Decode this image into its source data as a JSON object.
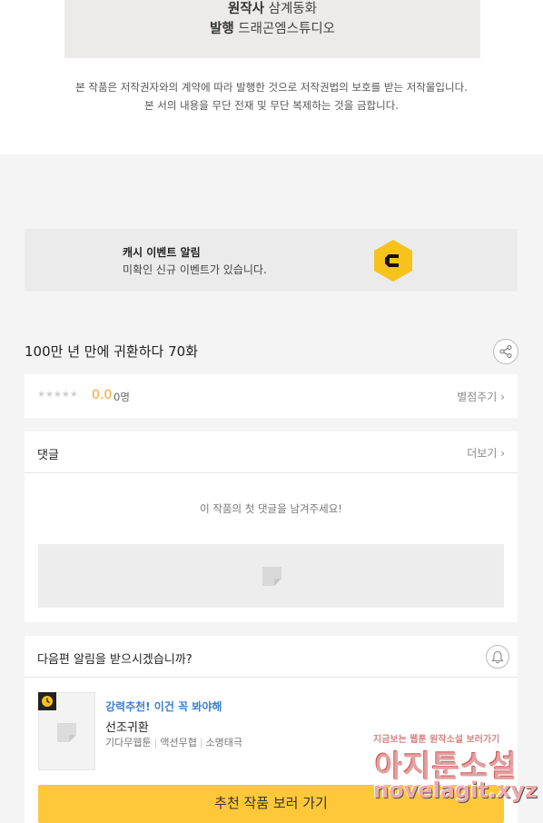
{
  "credits": {
    "original_label": "원작사",
    "original_value": "삼계동화",
    "publisher_label": "발행",
    "publisher_value": "드래곤엠스튜디오"
  },
  "copyright": {
    "line1": "본 작품은 저작권자와의 계약에 따라 발행한 것으로 저작권법의 보호를 받는 저작물입니다.",
    "line2": "본 서의 내용을 무단 전재 및 무단 복제하는 것을 금합니다."
  },
  "cash_event": {
    "title": "캐시 이벤트 알림",
    "subtitle": "미확인 신규 이벤트가 있습니다.",
    "logo_letter": "C",
    "logo_color": "#f7c21a"
  },
  "episode": {
    "title": "100만 년 만에 귀환하다 70화",
    "share_icon": "share-icon"
  },
  "rating": {
    "stars": "★★★★★",
    "score": "0.0",
    "count": "0명",
    "action": "별점주기"
  },
  "comments": {
    "title": "댓글",
    "more": "더보기",
    "empty_message": "이 작품의 첫 댓글을 남겨주세요!"
  },
  "notify": {
    "question": "다음편 알림을 받으시겠습니까?",
    "bell_icon": "bell-icon"
  },
  "recommendation": {
    "label": "강력추천! 이건 꼭 봐야해",
    "name": "선조귀환",
    "tags": [
      "기다무웹툰",
      "액션무협",
      "소명태극"
    ],
    "button": "추천 작품 보러 가기",
    "accent_color": "#ffc83a"
  },
  "watermark": {
    "small_text": "지금보는 웹툰 원작소설 보러가기",
    "big_text": "아지툰소설",
    "url": "novelagit.xyz"
  },
  "chevron": "›"
}
